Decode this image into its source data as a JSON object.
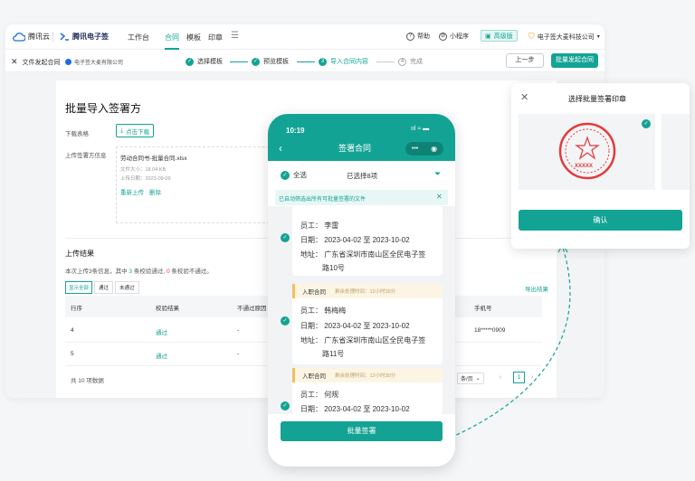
{
  "brand": {
    "logo": "腾讯云",
    "product": "腾讯电子签"
  },
  "nav": {
    "items": [
      "工作台",
      "合同",
      "模板",
      "印章"
    ],
    "help": "帮助",
    "mini": "小程序",
    "pro": "高级版",
    "company": "电子签大麦科技公司"
  },
  "steps": {
    "back": "文件发起合同",
    "company": "电子签大麦有限公司",
    "s1": "选择模板",
    "s2": "预览模板",
    "s3n": "3",
    "s3": "导入合同内容",
    "s4n": "4",
    "s4": "完成",
    "prev": "上一步",
    "launch": "批量发起合同"
  },
  "main": {
    "title": "批量导入签署方",
    "download_label": "下载表格",
    "download_btn": "点击下载",
    "upload_label": "上传签署方信息",
    "file_name": "劳动合同书-批量合同.xlsx",
    "file_size": "文件大小：18.04 KB",
    "file_date": "上传日期：2023-09-09",
    "reupload": "重新上传",
    "delete": "删除"
  },
  "result": {
    "title": "上传结果",
    "summary_a": "本次上传3条信息，其中 ",
    "ok": "3",
    "summary_b": " 条校验通过, ",
    "fail": "0",
    "summary_c": " 条校验不通过。",
    "tabs": [
      "显示全部",
      "通过",
      "未通过"
    ],
    "export": "导出结果",
    "headers": [
      "行序",
      "校验结果",
      "不通过原因",
      "手机号"
    ],
    "rows": [
      {
        "no": "4",
        "status": "通过",
        "reason": "-",
        "phone": "18*****0909"
      },
      {
        "no": "5",
        "status": "通过",
        "reason": "-",
        "phone": ""
      }
    ],
    "total": "共 10 项数据",
    "per_page": "条/页",
    "page": "1"
  },
  "phone": {
    "time": "10:19",
    "title": "签署合同",
    "select_all": "全选",
    "selected": "已选择8项",
    "notice": "已自动筛选出所有可批量签署的文件",
    "lbl_emp": "员工：",
    "lbl_date": "日期：",
    "lbl_addr": "地址：",
    "cards": [
      {
        "employee": "李雷",
        "date": "2023-04-02 至 2023-10-02",
        "addr1": "广东省深圳市南山区全民电子签",
        "addr2": "路10号"
      },
      {
        "tag": "入职合同",
        "time": "剩余处理时间：12小时30分",
        "employee": "韩梅梅",
        "date": "2023-04-02 至 2023-10-02",
        "addr1": "广东省深圳市南山区全民电子签",
        "addr2": "路11号"
      },
      {
        "tag": "入职合同",
        "time": "剩余处理时间：12小时30分",
        "employee": "何规",
        "date": "2023-04-02 至 2023-10-02"
      }
    ],
    "batch_sign": "批量签署"
  },
  "seal_panel": {
    "title": "选择批量签署印章",
    "confirm": "确认",
    "seal_text": "XXXXX"
  }
}
